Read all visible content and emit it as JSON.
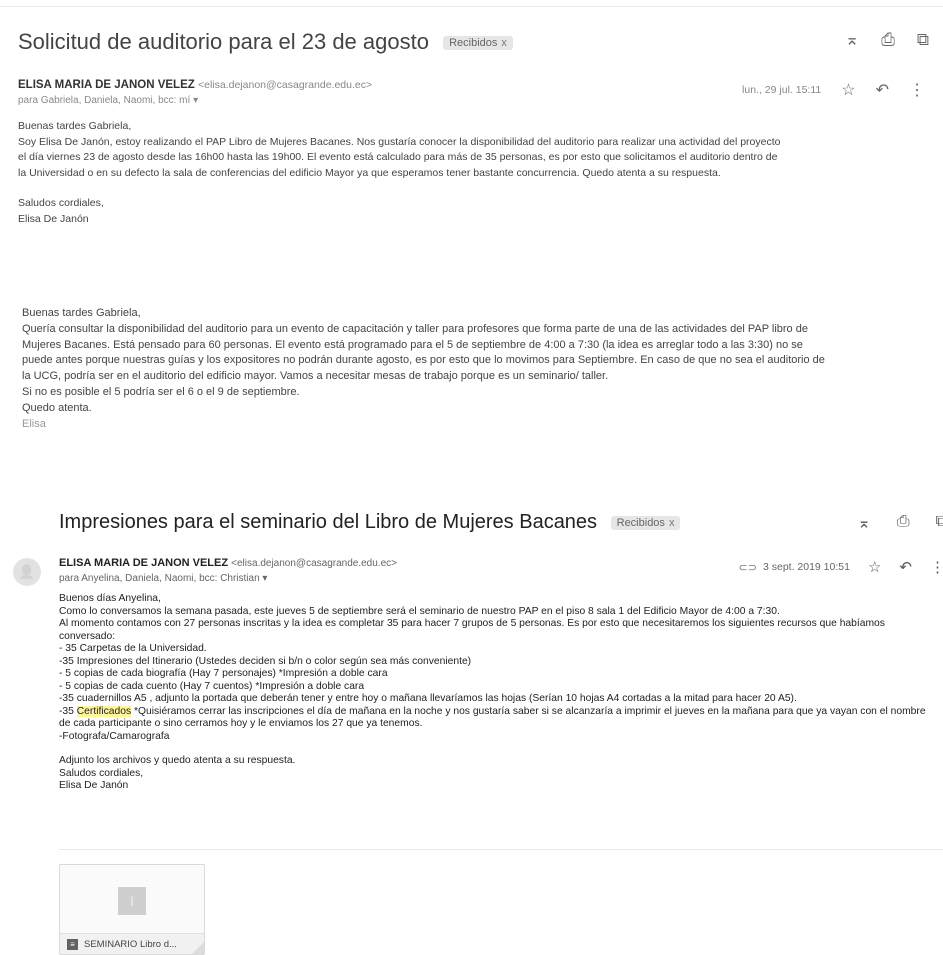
{
  "email1": {
    "subject": "Solicitud de auditorio para el 23 de agosto",
    "label": "Recibidos",
    "label_close": "x",
    "actions": {
      "toggle": "⌅",
      "print": "⎙",
      "popout": "⧉"
    },
    "sender_name": "ELISA MARIA DE JANON VELEZ",
    "sender_email": "<elisa.dejanon@casagrande.edu.ec>",
    "recipients": "para Gabriela, Daniela, Naomi, bcc: mí ▾",
    "date": "lun., 29 jul. 15:11",
    "star": "☆",
    "reply": "↶",
    "more": "⋮",
    "body_part1": {
      "greeting": "Buenas tardes Gabriela,",
      "line1": "Soy Elisa De Janón, estoy realizando el PAP Libro de Mujeres Bacanes. Nos gustaría conocer la disponibilidad del auditorio para realizar una actividad del proyecto",
      "line2": "el día viernes 23 de agosto desde las 16h00 hasta las 19h00. El evento está calculado para más de 35 personas, es por esto que solicitamos el auditorio dentro de",
      "line3": "la Universidad o en su defecto la sala de conferencias del edificio Mayor ya que esperamos tener bastante concurrencia. Quedo atenta a su respuesta.",
      "closing": "Saludos cordiales,",
      "signature": "Elisa De Janón"
    },
    "body_part2": {
      "greeting": "Buenas tardes Gabriela,",
      "line1": "Quería consultar la disponibilidad del auditorio para un evento de capacitación y taller para profesores que forma parte de una de las actividades del PAP libro de",
      "line2": "Mujeres Bacanes. Está pensado para 60 personas. El evento está programado para el 5 de septiembre de 4:00 a 7:30 (la idea es arreglar todo a las 3:30) no se",
      "line3": "puede antes porque nuestras guías y los expositores no podrán durante agosto, es por esto que lo movimos para Septiembre. En caso de que no sea el auditorio de",
      "line4": "la UCG, podría ser en el auditorio del edificio mayor. Vamos a necesitar mesas de trabajo porque es un seminario/ taller.",
      "line5": "Si no es posible el 5 podría ser el 6 o el 9 de septiembre.",
      "line6": "Quedo atenta.",
      "signature": "Elisa"
    }
  },
  "email2": {
    "subject": "Impresiones para el seminario del Libro de Mujeres Bacanes",
    "label": "Recibidos",
    "label_close": "x",
    "actions": {
      "toggle": "⌅",
      "print": "⎙",
      "popout": "⧉"
    },
    "avatar_glyph": "👤",
    "sender_name": "ELISA MARIA DE JANON VELEZ",
    "sender_email": "<elisa.dejanon@casagrande.edu.ec>",
    "recipients": "para Anyelina, Daniela, Naomi, bcc: Christian ▾",
    "attachment_glyph": "⊂⊃",
    "date": "3 sept. 2019 10:51",
    "star": "☆",
    "reply": "↶",
    "more": "⋮",
    "body": {
      "l1": "Buenos días Anyelina,",
      "l2": "Como lo conversamos la semana pasada, este jueves 5 de septiembre será el seminario de nuestro PAP en el piso 8 sala 1 del Edificio Mayor de 4:00 a 7:30.",
      "l3": "Al momento contamos con 27 personas inscritas y la idea es completar 35 para hacer 7 grupos de 5 personas. Es por esto que necesitaremos los siguientes recursos que habíamos",
      "l4": "conversado:",
      "l5": "- 35 Carpetas de la Universidad.",
      "l6": "-35 Impresiones del Itinerario (Ustedes deciden si b/n o color según sea más conveniente)",
      "l7": "- 5 copias de cada biografía (Hay 7 personajes) *Impresión a doble cara",
      "l8": "- 5 copias de cada cuento (Hay 7 cuentos) *Impresión a doble cara",
      "l9": "-35 cuadernillos A5 , adjunto la portada que deberán tener y entre hoy o mañana llevaríamos las hojas (Serían 10 hojas A4 cortadas a la mitad para hacer 20 A5).",
      "l10_prefix": "-35 ",
      "l10_highlight": "Certificados",
      "l10_rest": " *Quisiéramos cerrar las inscripciones el día de mañana en la noche y nos gustaría saber si se alcanzaría a imprimir el jueves en la mañana para que ya vayan con el nombre",
      "l11": "de cada participante o sino cerramos hoy y le enviamos los 27 que ya tenemos.",
      "l12": "-Fotografa/Camarografa",
      "l13": "Adjunto los archivos y quedo atenta a su respuesta.",
      "l14": "Saludos cordiales,",
      "l15": "Elisa De Janón"
    },
    "attachment": {
      "thumb_glyph": "|",
      "file_icon": "≡",
      "name": "SEMINARIO Libro d..."
    }
  }
}
